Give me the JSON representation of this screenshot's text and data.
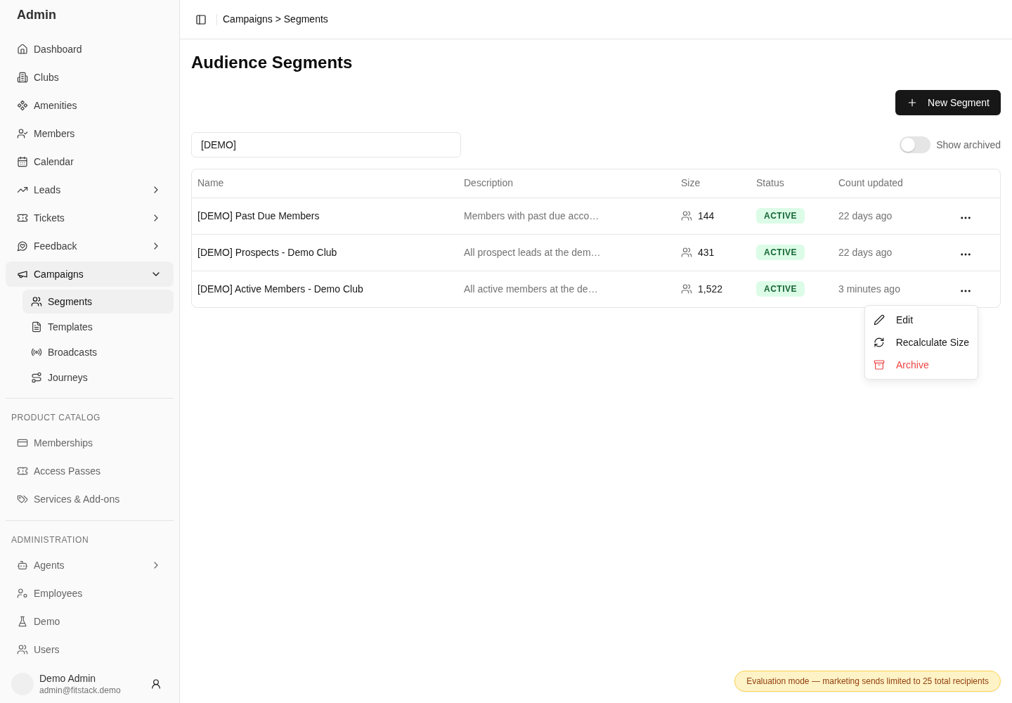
{
  "sidebar": {
    "title": "Admin",
    "sections": [
      {
        "items": [
          {
            "label": "Dashboard",
            "selected": false
          },
          {
            "label": "Clubs",
            "selected": false
          },
          {
            "label": "Amenities",
            "selected": false
          },
          {
            "label": "Members",
            "selected": false
          },
          {
            "label": "Calendar",
            "selected": false
          },
          {
            "label": "Leads",
            "selected": false,
            "expanded": false
          },
          {
            "label": "Tickets",
            "selected": false,
            "expanded": false
          },
          {
            "label": "Feedback",
            "selected": false,
            "expanded": false
          },
          {
            "label": "Campaigns",
            "selected": true,
            "expanded": true,
            "children": [
              {
                "label": "Segments",
                "selected": true
              },
              {
                "label": "Templates",
                "selected": false
              },
              {
                "label": "Broadcasts",
                "selected": false
              },
              {
                "label": "Journeys",
                "selected": false
              }
            ]
          }
        ]
      },
      {
        "label": "PRODUCT CATALOG",
        "items": [
          {
            "label": "Memberships",
            "selected": false
          },
          {
            "label": "Access Passes",
            "selected": false
          },
          {
            "label": "Services & Add-ons",
            "selected": false
          }
        ]
      },
      {
        "label": "ADMINISTRATION",
        "items": [
          {
            "label": "Agents",
            "selected": false,
            "expanded": false
          },
          {
            "label": "Employees",
            "selected": false
          },
          {
            "label": "Demo",
            "selected": false
          },
          {
            "label": "Users",
            "selected": false
          }
        ]
      }
    ],
    "user": {
      "name": "Demo Admin",
      "email": "admin@fitstack.demo"
    }
  },
  "header": {
    "breadcrumb": "Campaigns > Segments"
  },
  "page": {
    "title": "Audience Segments",
    "new_button": "New Segment",
    "search": {
      "value": "[DEMO]"
    },
    "show_archived": {
      "label": "Show archived",
      "on": false
    }
  },
  "table": {
    "columns": [
      "Name",
      "Description",
      "Size",
      "Status",
      "Count updated"
    ],
    "rows": [
      {
        "name": "[DEMO] Past Due Members",
        "description": "Members with past due acco…",
        "size": "144",
        "status": "ACTIVE",
        "count_updated": "22 days ago",
        "menu_open": false
      },
      {
        "name": "[DEMO] Prospects - Demo Club",
        "description": "All prospect leads at the dem…",
        "size": "431",
        "status": "ACTIVE",
        "count_updated": "22 days ago",
        "menu_open": false
      },
      {
        "name": "[DEMO] Active Members - Demo Club",
        "description": "All active members at the de…",
        "size": "1,522",
        "status": "ACTIVE",
        "count_updated": "3 minutes ago",
        "menu_open": true
      }
    ]
  },
  "row_menu": {
    "items": [
      {
        "label": "Edit",
        "kind": "default"
      },
      {
        "label": "Recalculate Size",
        "kind": "default"
      },
      {
        "label": "Archive",
        "kind": "danger"
      }
    ]
  },
  "banner": "Evaluation mode — marketing sends limited to 25 total recipients"
}
